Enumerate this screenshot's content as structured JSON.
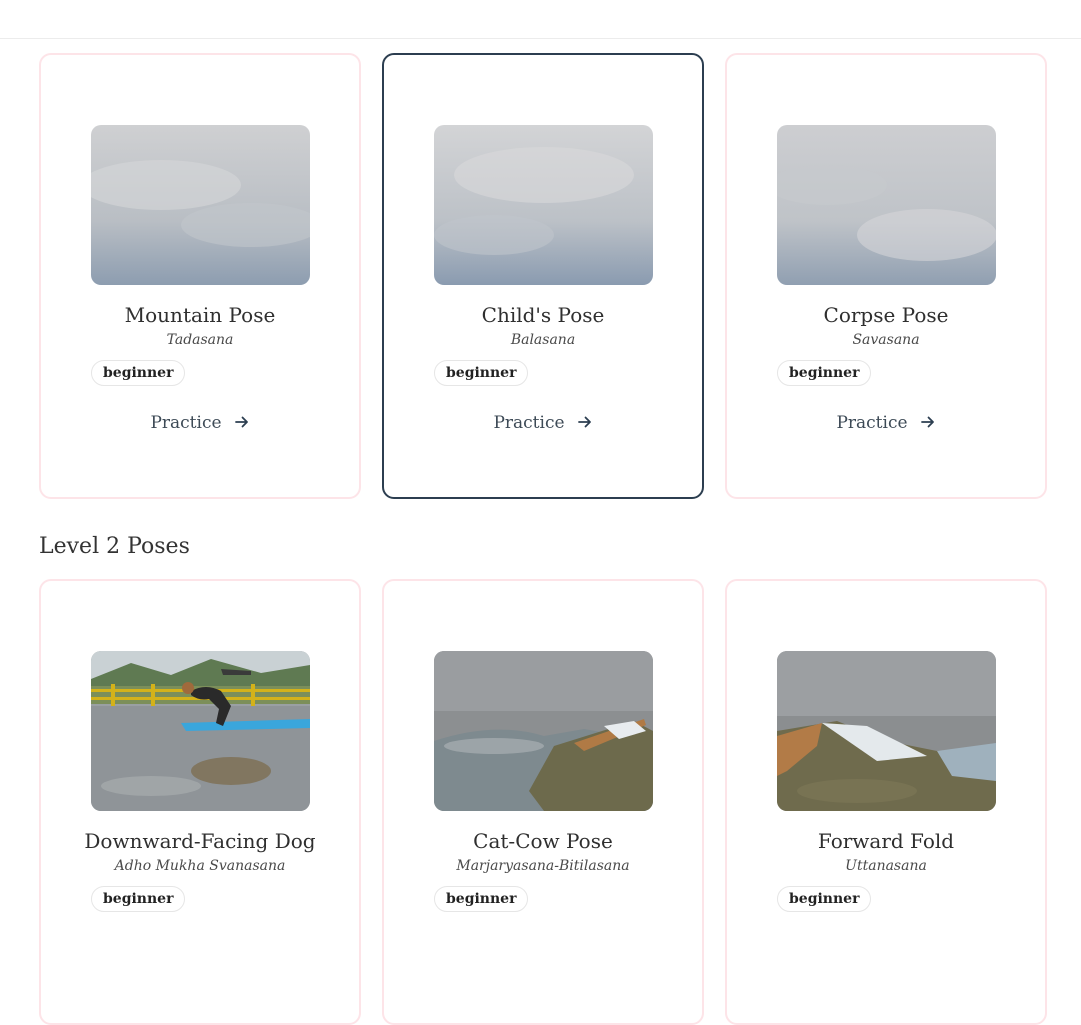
{
  "level1": {
    "cards": [
      {
        "title": "Mountain Pose",
        "sanskrit": "Tadasana",
        "badge": "beginner",
        "action": "Practice",
        "image": "cloudy-sky-photo"
      },
      {
        "title": "Child's Pose",
        "sanskrit": "Balasana",
        "badge": "beginner",
        "action": "Practice",
        "image": "cloudy-sky-photo"
      },
      {
        "title": "Corpse Pose",
        "sanskrit": "Savasana",
        "badge": "beginner",
        "action": "Practice",
        "image": "cloudy-sky-photo"
      }
    ]
  },
  "level2": {
    "heading": "Level 2 Poses",
    "cards": [
      {
        "title": "Downward-Facing Dog",
        "sanskrit": "Adho Mukha Svanasana",
        "badge": "beginner",
        "image": "yoga-crow-pose-photo"
      },
      {
        "title": "Cat-Cow Pose",
        "sanskrit": "Marjaryasana-Bitilasana",
        "badge": "beginner",
        "image": "puddle-reflection-photo"
      },
      {
        "title": "Forward Fold",
        "sanskrit": "Uttanasana",
        "badge": "beginner",
        "image": "puddle-reflection-photo"
      }
    ]
  },
  "icons": {
    "practice": "arrow-right-icon"
  },
  "colors": {
    "card_border": "#fde4e8",
    "active_border": "#2c3e50",
    "text": "#2c3e50"
  }
}
